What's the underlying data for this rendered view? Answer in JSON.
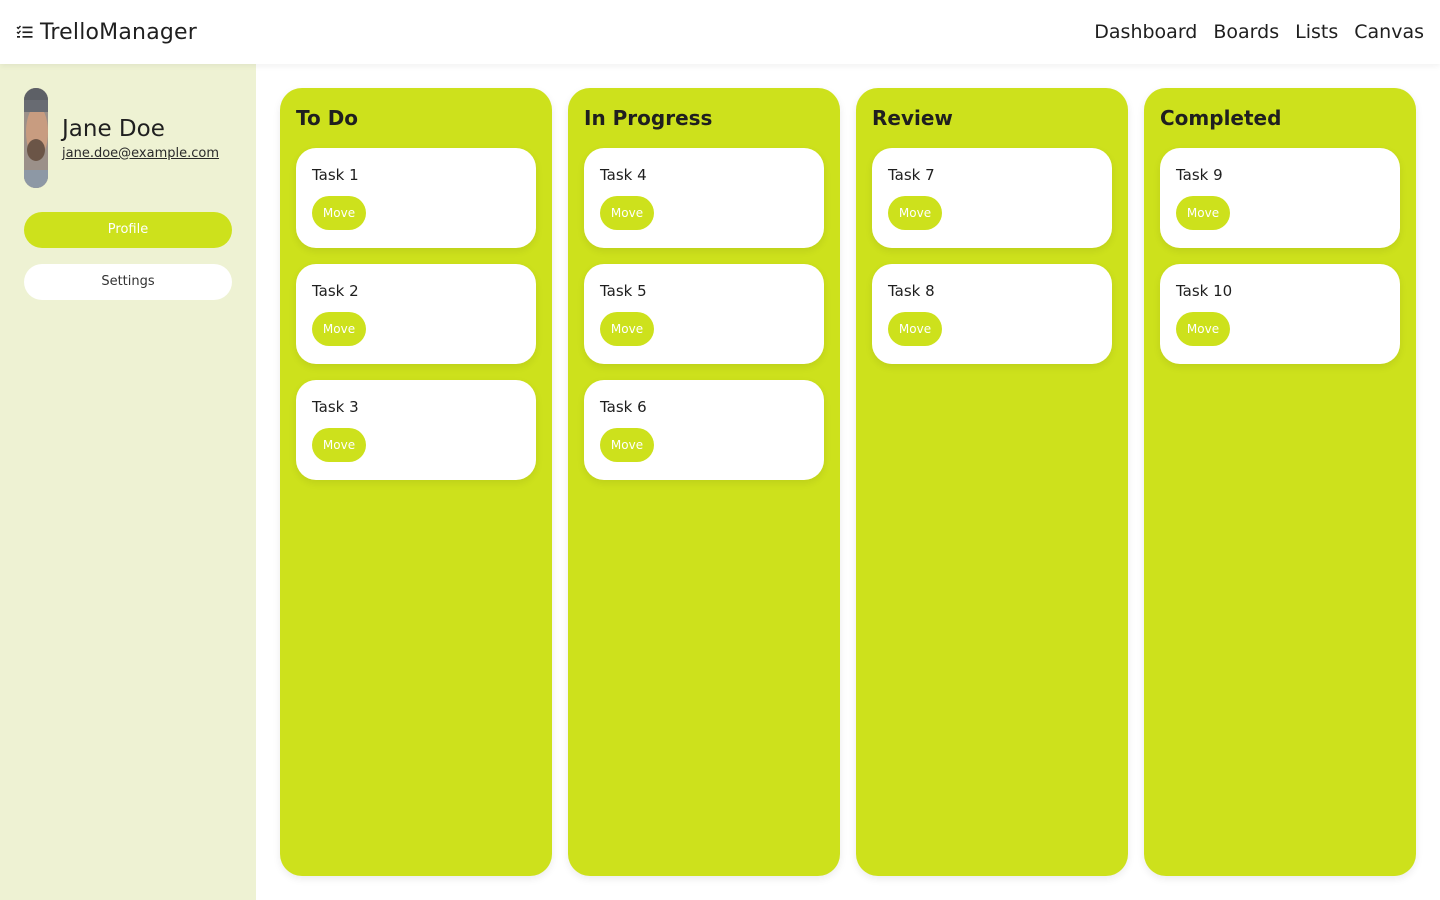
{
  "app": {
    "title": "TrelloManager"
  },
  "colors": {
    "accent": "#cde11c",
    "sidebar_bg": "#eef2d3",
    "card_bg": "#ffffff"
  },
  "nav": {
    "dashboard": "Dashboard",
    "boards": "Boards",
    "lists": "Lists",
    "canvas": "Canvas"
  },
  "user": {
    "name": "Jane Doe",
    "email": "jane.doe@example.com"
  },
  "sidebar": {
    "profile_label": "Profile",
    "settings_label": "Settings"
  },
  "columns": [
    {
      "title": "To Do",
      "cards": [
        {
          "title": "Task 1",
          "action": "Move"
        },
        {
          "title": "Task 2",
          "action": "Move"
        },
        {
          "title": "Task 3",
          "action": "Move"
        }
      ]
    },
    {
      "title": "In Progress",
      "cards": [
        {
          "title": "Task 4",
          "action": "Move"
        },
        {
          "title": "Task 5",
          "action": "Move"
        },
        {
          "title": "Task 6",
          "action": "Move"
        }
      ]
    },
    {
      "title": "Review",
      "cards": [
        {
          "title": "Task 7",
          "action": "Move"
        },
        {
          "title": "Task 8",
          "action": "Move"
        }
      ]
    },
    {
      "title": "Completed",
      "cards": [
        {
          "title": "Task 9",
          "action": "Move"
        },
        {
          "title": "Task 10",
          "action": "Move"
        }
      ]
    }
  ]
}
